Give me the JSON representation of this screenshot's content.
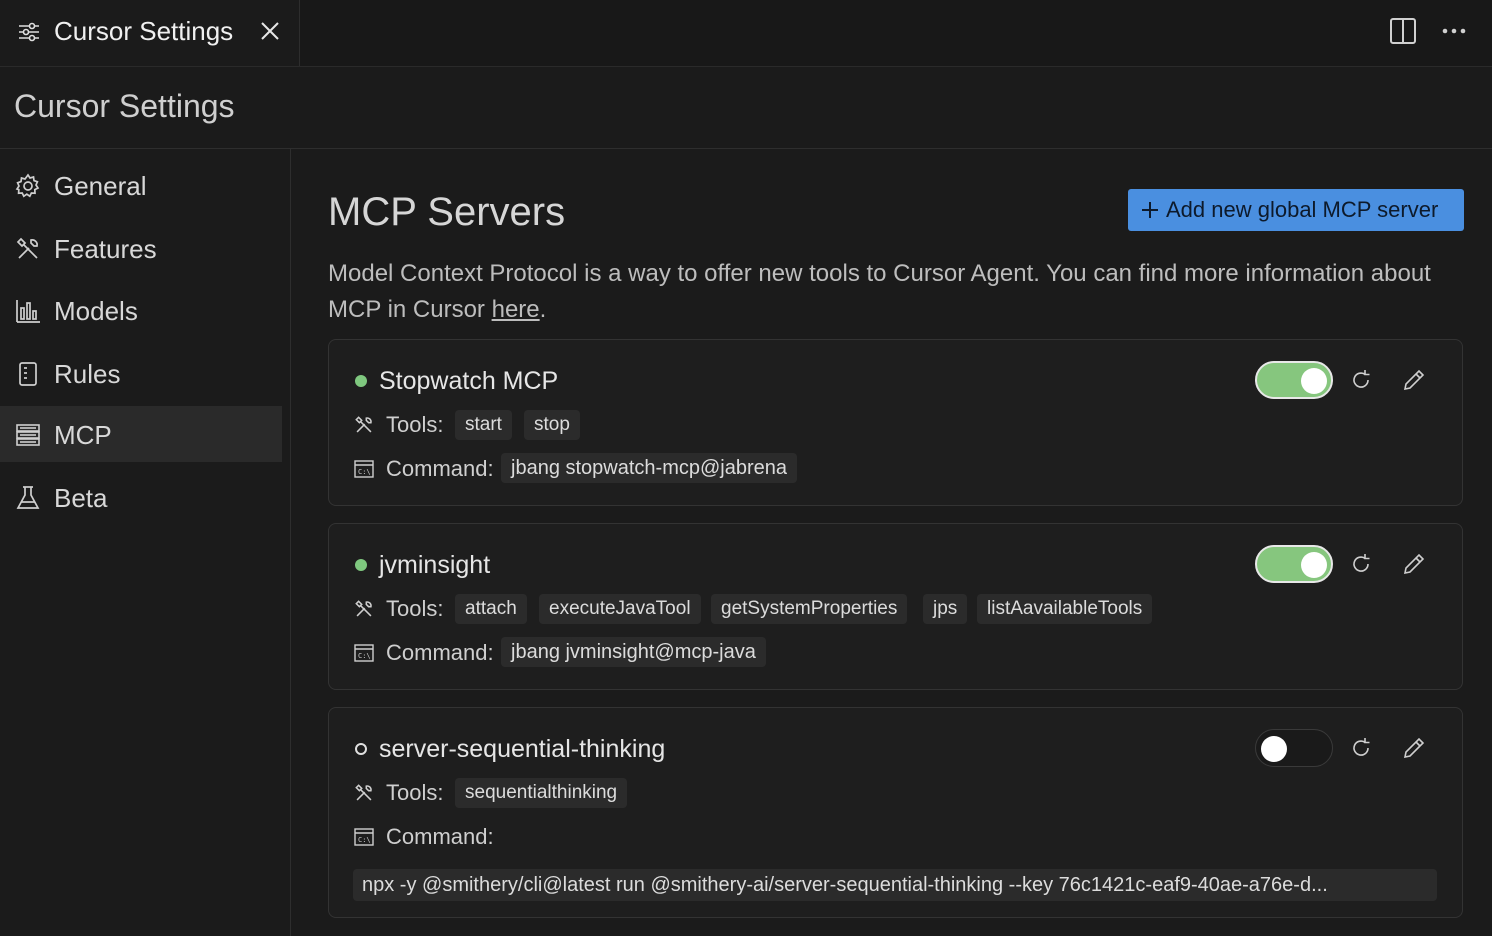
{
  "tab": {
    "title": "Cursor Settings"
  },
  "page": {
    "title": "Cursor Settings"
  },
  "sidebar": {
    "items": [
      {
        "label": "General",
        "icon": "gear-icon"
      },
      {
        "label": "Features",
        "icon": "tools-icon"
      },
      {
        "label": "Models",
        "icon": "chart-icon"
      },
      {
        "label": "Rules",
        "icon": "book-icon"
      },
      {
        "label": "MCP",
        "icon": "server-icon",
        "active": true
      },
      {
        "label": "Beta",
        "icon": "flask-icon"
      }
    ]
  },
  "main": {
    "title": "MCP Servers",
    "add_button": "Add new global MCP server",
    "description": "Model Context Protocol is a way to offer new tools to Cursor Agent. You can find more information about MCP in Cursor ",
    "description_link": "here",
    "description_end": ".",
    "tools_label": "Tools:",
    "command_label": "Command:"
  },
  "servers": [
    {
      "name": "Stopwatch MCP",
      "enabled": true,
      "tools": [
        "start",
        "stop"
      ],
      "command": "jbang stopwatch-mcp@jabrena"
    },
    {
      "name": "jvminsight",
      "enabled": true,
      "tools": [
        "attach",
        "executeJavaTool",
        "getSystemProperties",
        "jps",
        "listAavailableTools"
      ],
      "command": "jbang jvminsight@mcp-java"
    },
    {
      "name": "server-sequential-thinking",
      "enabled": false,
      "tools": [
        "sequentialthinking"
      ],
      "command": "npx -y @smithery/cli@latest run @smithery-ai/server-sequential-thinking --key 76c1421c-eaf9-40ae-a76e-d..."
    }
  ],
  "colors": {
    "accent": "#4a8fe0",
    "status_on": "#7fc87f",
    "toggle_on": "#86c67e"
  }
}
